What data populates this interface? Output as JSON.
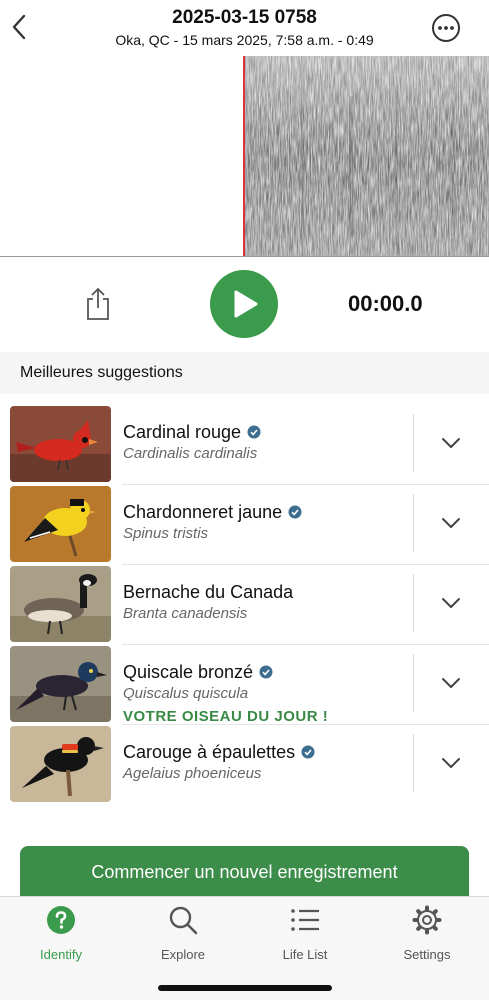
{
  "header": {
    "title": "2025-03-15 0758",
    "subtitle": "Oka, QC - 15 mars 2025, 7:58 a.m. - 0:49",
    "back_icon": "chevron-left-icon",
    "more_icon": "ellipsis-circle-icon"
  },
  "player": {
    "share_icon": "share-icon",
    "play_icon": "play-icon",
    "time": "00:00.0",
    "accent": "#3a9b4d",
    "playhead_color": "#d9343b"
  },
  "suggestions": {
    "heading": "Meilleures suggestions",
    "items": [
      {
        "common": "Cardinal rouge",
        "scientific": "Cardinalis cardinalis",
        "verified": true
      },
      {
        "common": "Chardonneret jaune",
        "scientific": "Spinus tristis",
        "verified": true
      },
      {
        "common": "Bernache du Canada",
        "scientific": "Branta canadensis",
        "verified": false
      },
      {
        "common": "Quiscale bronzé",
        "scientific": "Quiscalus quiscula",
        "verified": true,
        "note": "VOTRE OISEAU DU JOUR !"
      },
      {
        "common": "Carouge à épaulettes",
        "scientific": "Agelaius phoeniceus",
        "verified": true
      }
    ]
  },
  "actions": {
    "new_recording": "Commencer un nouvel enregistrement"
  },
  "tabbar": {
    "tabs": [
      {
        "label": "Identify",
        "icon": "question-circle-icon",
        "active": true
      },
      {
        "label": "Explore",
        "icon": "search-icon",
        "active": false
      },
      {
        "label": "Life List",
        "icon": "list-icon",
        "active": false
      },
      {
        "label": "Settings",
        "icon": "gear-icon",
        "active": false
      }
    ]
  }
}
